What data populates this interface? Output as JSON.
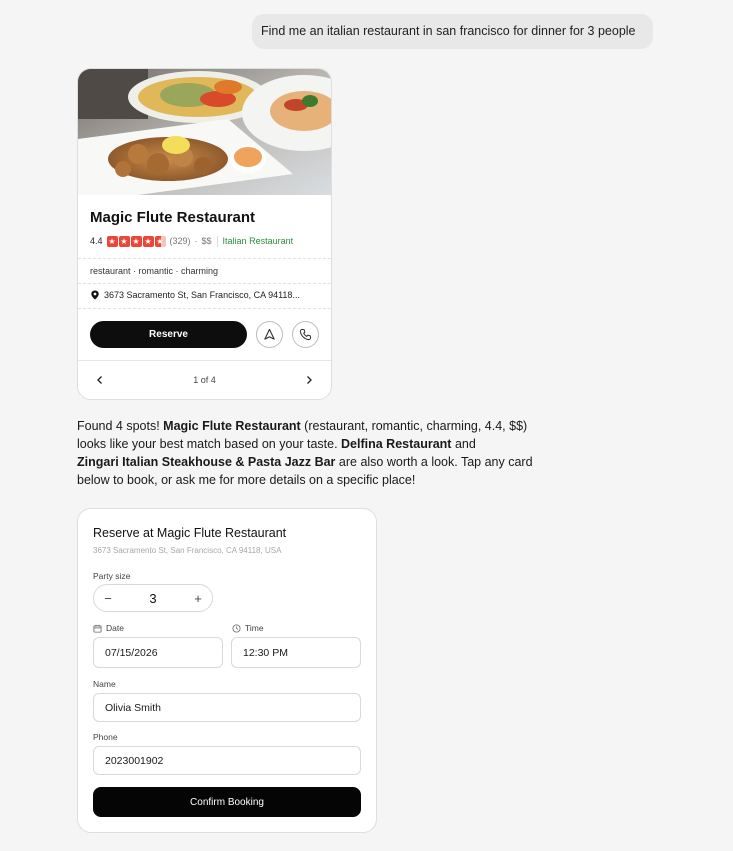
{
  "user_message": "Find me an italian restaurant in san francisco for dinner for 3 people",
  "restaurant_card": {
    "name": "Magic Flute Restaurant",
    "rating": "4.4",
    "stars_value": 4.4,
    "review_count": "(329)",
    "dot": "·",
    "price": "$$",
    "category": "Italian Restaurant",
    "tags": "restaurant · romantic · charming",
    "address": "3673 Sacramento St, San Francisco, CA 94118...",
    "reserve_label": "Reserve",
    "pager_label": "1 of 4",
    "star_color": "#e8473a",
    "category_color": "#2e8b3c",
    "icons": [
      "photo",
      "star-icon",
      "location-pin-icon",
      "navigate-arrow-icon",
      "phone-icon",
      "chevron-left-icon",
      "chevron-right-icon"
    ]
  },
  "assistant_message": {
    "intro": "Found 4 spots! ",
    "best_name": "Magic Flute Restaurant",
    "best_details": " (restaurant, romantic, charming, 4.4, $$) looks like your best match based on your taste. ",
    "alt_1": "Delfina Restaurant",
    "and_text": " and ",
    "alt_2": "Zingari Italian Steakhouse & Pasta Jazz Bar",
    "outro": " are also worth a look. Tap any card below to book, or ask me for more details on a specific place!"
  },
  "booking_form": {
    "title": "Reserve at Magic Flute Restaurant",
    "address": "3673 Sacramento St, San Francisco, CA 94118, USA",
    "party_size_label": "Party size",
    "party_size": "3",
    "minus": "−",
    "plus": "+",
    "date_label": "Date",
    "date_value": "07/15/2026",
    "time_label": "Time",
    "time_value": "12:30 PM",
    "name_label": "Name",
    "name_value": "Olivia Smith",
    "phone_label": "Phone",
    "phone_value": "2023001902",
    "confirm_label": "Confirm Booking"
  }
}
